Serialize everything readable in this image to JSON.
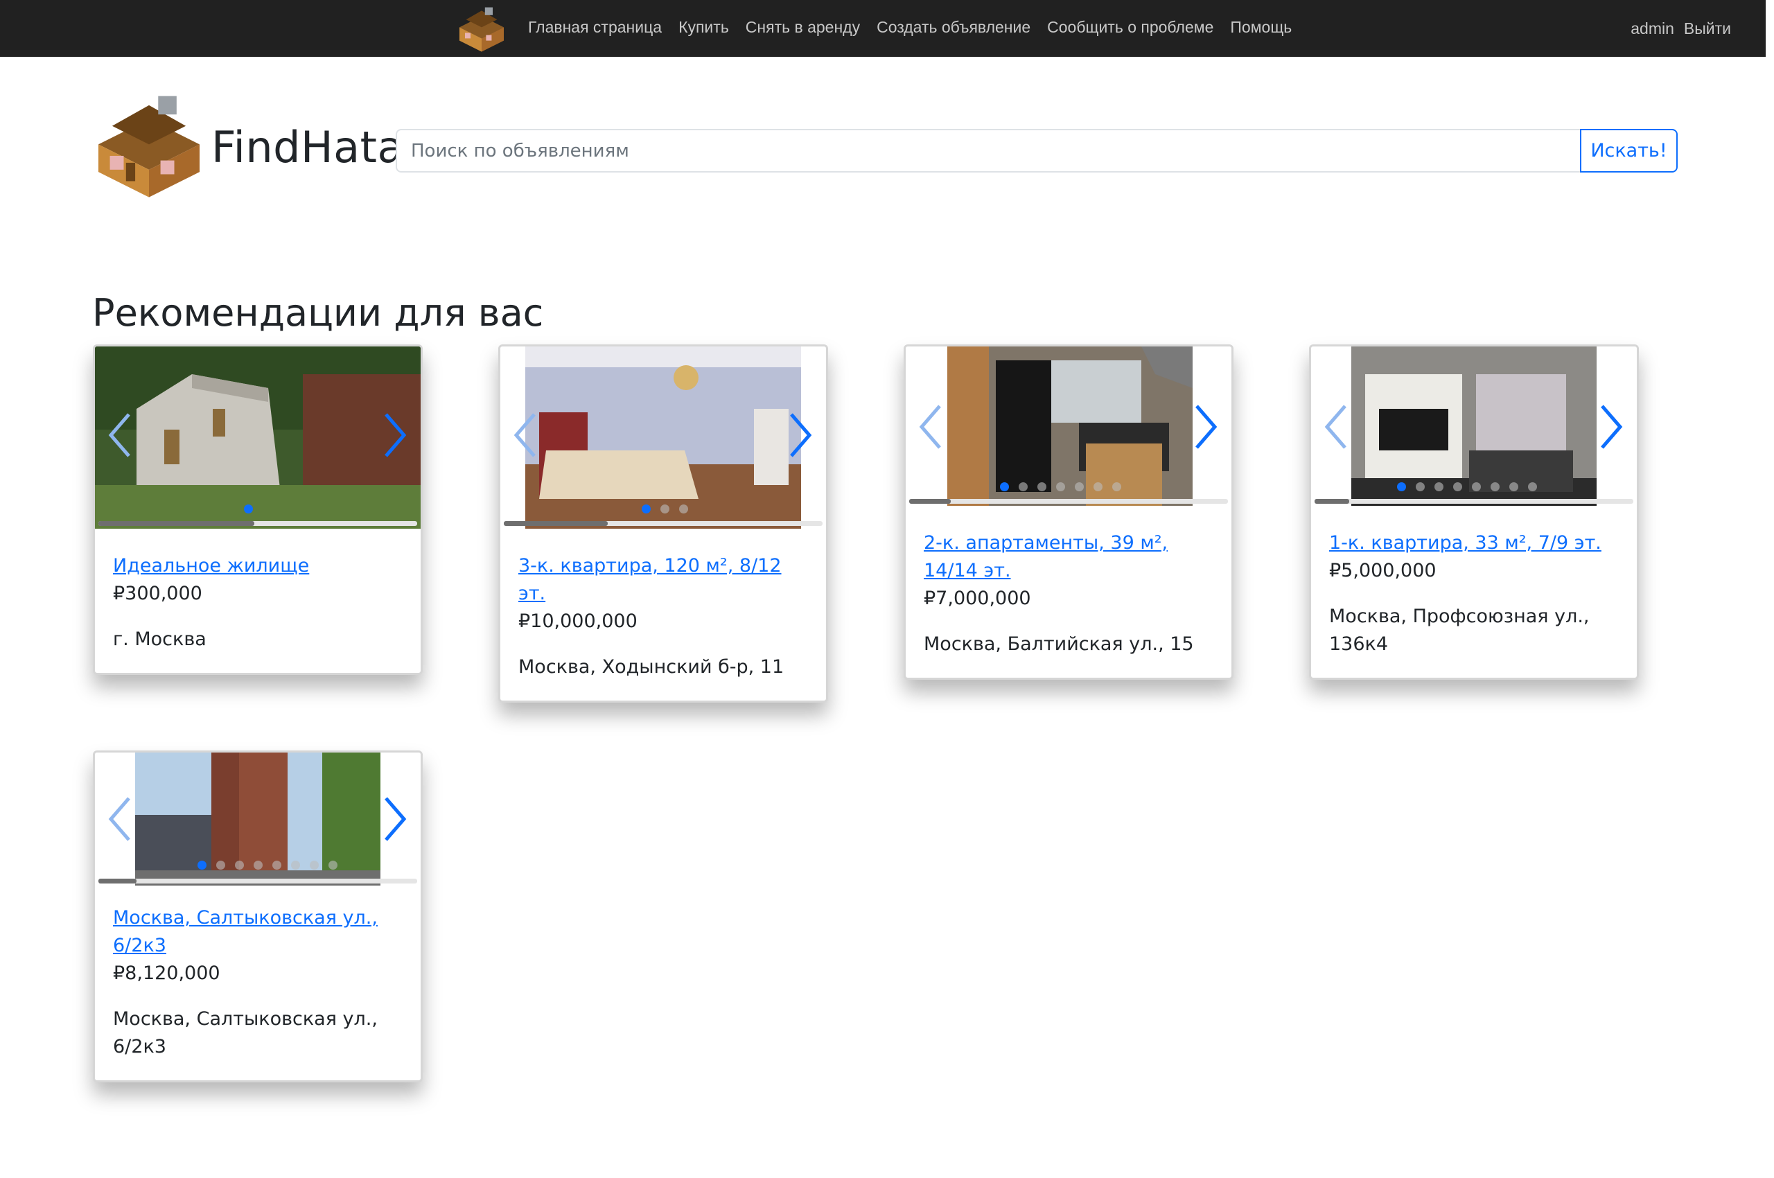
{
  "nav": {
    "links": [
      "Главная страница",
      "Купить",
      "Снять в аренду",
      "Создать объявление",
      "Сообщить о проблеме",
      "Помощь"
    ],
    "user": "admin",
    "logout": "Выйти"
  },
  "brand": {
    "name": "FindHata"
  },
  "search": {
    "placeholder": "Поиск по объявлениям",
    "button": "Искать!"
  },
  "section_title": "Рекомендации для вас",
  "listings": [
    {
      "title": "Идеальное жилище",
      "price": "₽300,000",
      "address": "г. Москва"
    },
    {
      "title": "3-к. квартира, 120 м², 8/12 эт.",
      "price": "₽10,000,000",
      "address": "Москва, Ходынский б-р, 11"
    },
    {
      "title": "2-к. апартаменты, 39 м², 14/14 эт.",
      "price": "₽7,000,000",
      "address": "Москва, Балтийская ул., 15"
    },
    {
      "title": "1-к. квартира, 33 м², 7/9 эт.",
      "price": "₽5,000,000",
      "address": "Москва, Профсоюзная ул., 136к4"
    },
    {
      "title": "Москва, Салтыковская ул., 6/2к3",
      "price": "₽8,120,000",
      "address": "Москва, Салтыковская ул., 6/2к3"
    }
  ],
  "colors": {
    "navbar": "#212121",
    "accent": "#0d6efd"
  },
  "icons": {
    "logo": "house-logo-icon",
    "prev": "chevron-left-icon",
    "next": "chevron-right-icon"
  }
}
